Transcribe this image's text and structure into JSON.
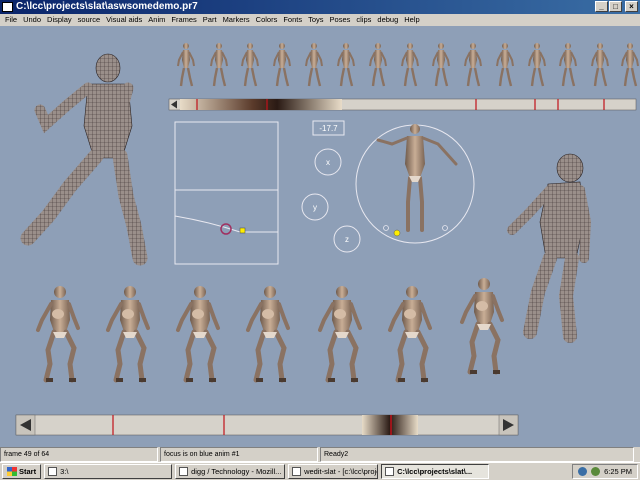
{
  "window": {
    "title": "C:\\lcc\\projects\\slat\\aswsomedemo.pr7",
    "minimize_glyph": "_",
    "maximize_glyph": "□",
    "close_glyph": "×"
  },
  "menu": {
    "items": [
      "File",
      "Undo",
      "Display",
      "source",
      "Visual aids",
      "Anim",
      "Frames",
      "Part",
      "Markers",
      "Colors",
      "Fonts",
      "Toys",
      "Poses",
      "clips",
      "debug",
      "Help"
    ]
  },
  "editor": {
    "rotation_value": "-17.7",
    "axis_x_label": "x",
    "axis_y_label": "y",
    "axis_z_label": "z",
    "timeline_left_arrow_icon": "left-arrow-icon",
    "timeline_right_arrow_icon": "right-arrow-icon"
  },
  "status": {
    "frame": "frame 49 of 64",
    "focus": "focus is on blue anim #1",
    "ready": "Ready2"
  },
  "taskbar": {
    "start_label": "Start",
    "tasks": [
      "3:\\",
      "digg / Technology - Mozill...",
      "wedit-slat - [c:\\lcc\\project...",
      "C:\\lcc\\projects\\slat\\..."
    ],
    "clock": "6:25 PM"
  },
  "colors": {
    "workspace_bg": "#8e9fb7",
    "figure_skin": "#b49a84",
    "accent_red": "#c0101a",
    "handle_yellow": "#ffee00"
  }
}
